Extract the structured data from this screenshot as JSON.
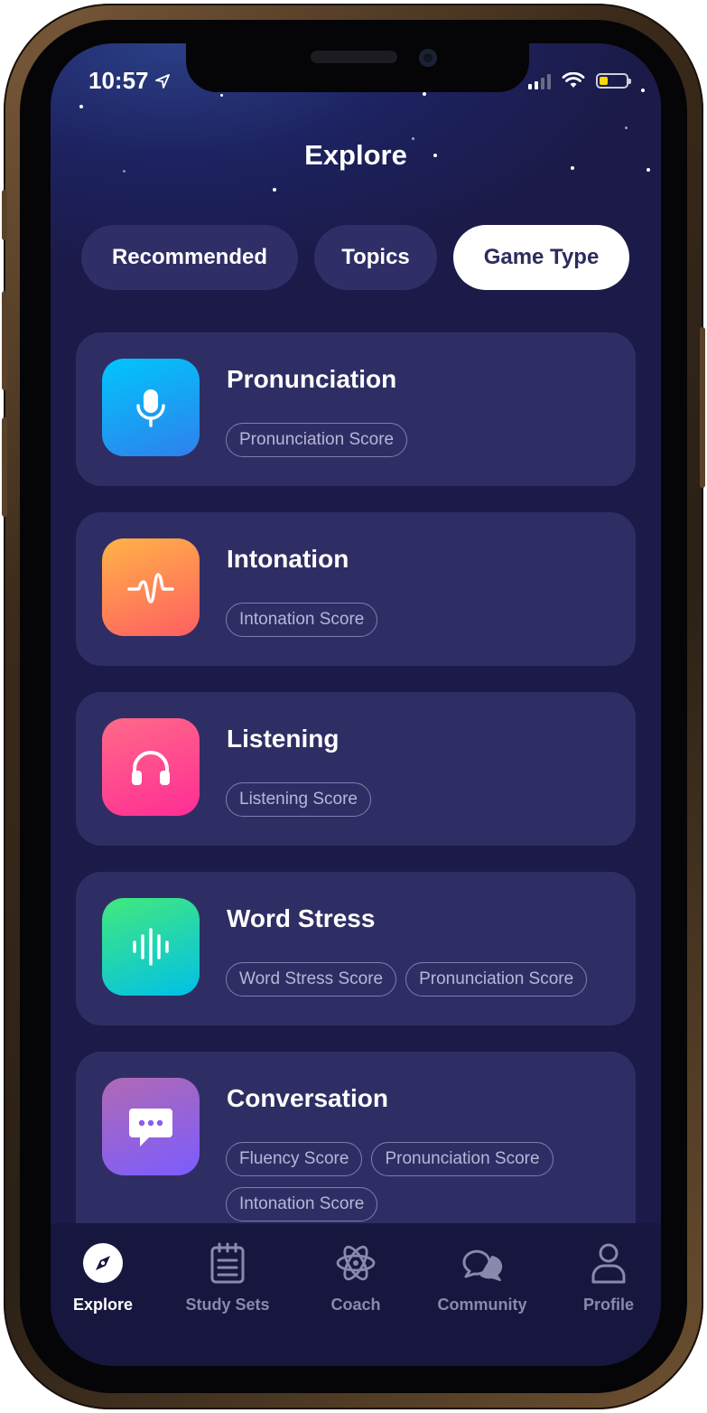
{
  "status_bar": {
    "time": "10:57"
  },
  "header": {
    "title": "Explore"
  },
  "filter_tabs": [
    {
      "label": "Recommended",
      "active": false
    },
    {
      "label": "Topics",
      "active": false
    },
    {
      "label": "Game Type",
      "active": true
    }
  ],
  "game_types": [
    {
      "title": "Pronunciation",
      "icon": "microphone-icon",
      "colors": [
        "#00c6fb",
        "#2f80ed"
      ],
      "badges": [
        "Pronunciation Score"
      ]
    },
    {
      "title": "Intonation",
      "icon": "waveform-icon",
      "colors": [
        "#ffb347",
        "#ff5e62"
      ],
      "badges": [
        "Intonation Score"
      ]
    },
    {
      "title": "Listening",
      "icon": "headphones-icon",
      "colors": [
        "#ff6a88",
        "#ff2d95"
      ],
      "badges": [
        "Listening Score"
      ]
    },
    {
      "title": "Word Stress",
      "icon": "sound-bars-icon",
      "colors": [
        "#43e97b",
        "#00c0e8"
      ],
      "badges": [
        "Word Stress Score",
        "Pronunciation Score"
      ]
    },
    {
      "title": "Conversation",
      "icon": "chat-bubble-icon",
      "colors": [
        "#b06ab3",
        "#7b5cff"
      ],
      "badges": [
        "Fluency Score",
        "Pronunciation Score",
        "Intonation Score"
      ]
    }
  ],
  "bottom_nav": [
    {
      "label": "Explore",
      "icon": "compass-icon",
      "active": true
    },
    {
      "label": "Study Sets",
      "icon": "notepad-icon",
      "active": false
    },
    {
      "label": "Coach",
      "icon": "atom-icon",
      "active": false
    },
    {
      "label": "Community",
      "icon": "chat-bubbles-icon",
      "active": false
    },
    {
      "label": "Profile",
      "icon": "person-icon",
      "active": false
    }
  ]
}
